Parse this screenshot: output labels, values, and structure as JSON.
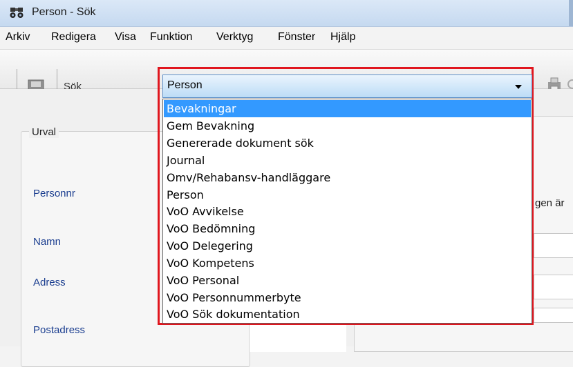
{
  "window": {
    "title": "Person - Sök"
  },
  "menu": [
    "Arkiv",
    "Redigera",
    "Visa",
    "Funktion",
    "Verktyg",
    "Fönster",
    "Hjälp"
  ],
  "toolbar": {
    "search_label": "Sök"
  },
  "combo": {
    "selected": "Person"
  },
  "dropdown": {
    "options": [
      "Bevakningar",
      "Gem Bevakning",
      "Genererade dokument sök",
      "Journal",
      "Omv/Rehabansv-handläggare",
      "Person",
      "VoO Avvikelse",
      "VoO Bedömning",
      "VoO Delegering",
      "VoO Kompetens",
      "VoO Personal",
      "VoO Personnummerbyte",
      "VoO Sök dokumentation"
    ],
    "highlighted": "Bevakningar"
  },
  "urval": {
    "title": "Urval",
    "fields": [
      "Personnr",
      "Namn",
      "Adress",
      "Postadress"
    ]
  },
  "right_panel": {
    "partial_text": "gen är"
  },
  "colors": {
    "highlight_border": "#e0161e",
    "selection": "#3399ff",
    "label_blue": "#1a3d8f"
  }
}
